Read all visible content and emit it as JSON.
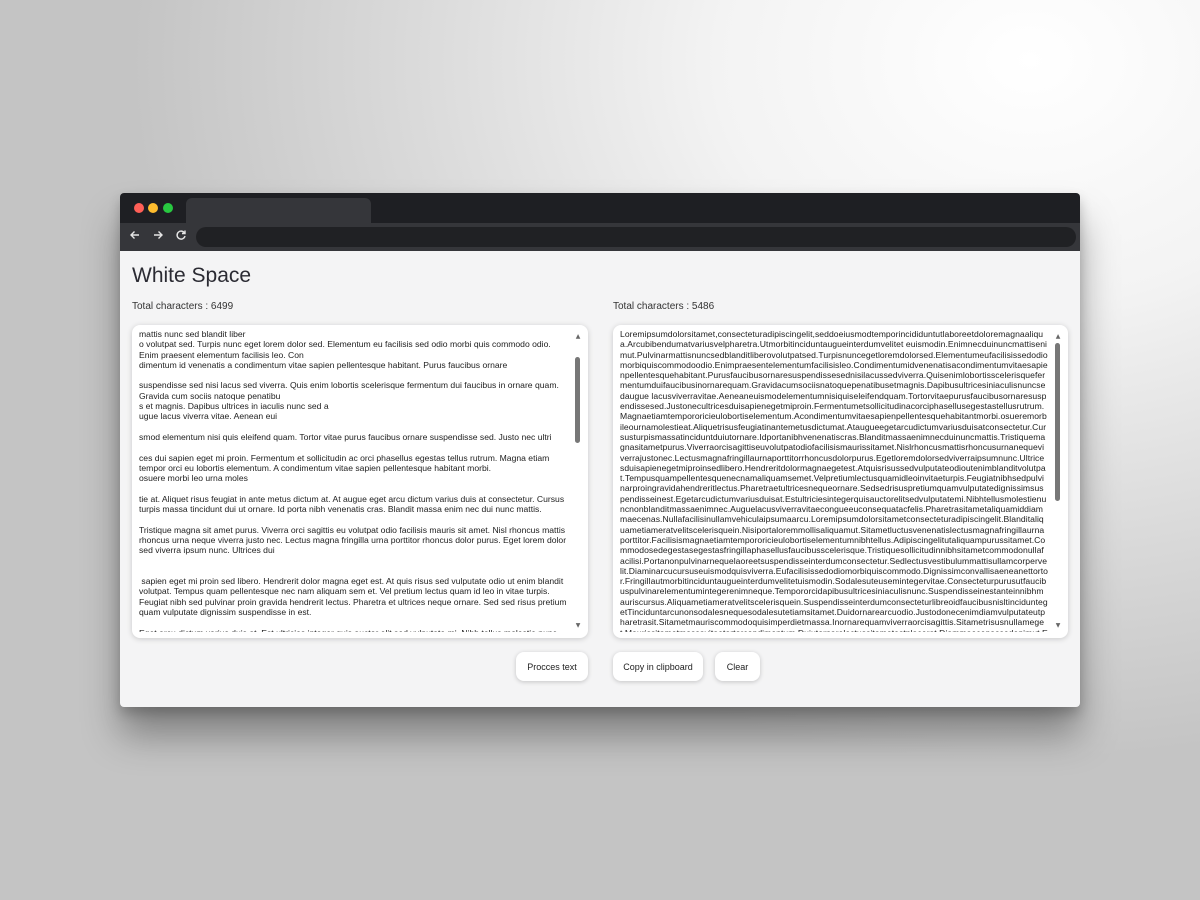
{
  "app": {
    "title": "White Space"
  },
  "left": {
    "count_label": "Total characters : 6499",
    "text": "mattis nunc sed blandit liber\no volutpat sed. Turpis nunc eget lorem dolor sed. Elementum eu facilisis sed odio morbi quis commodo odio. Enim praesent elementum facilisis leo. Con\ndimentum id venenatis a condimentum vitae sapien pellentesque habitant. Purus faucibus ornare\n\nsuspendisse sed nisi lacus sed viverra. Quis enim lobortis scelerisque fermentum dui faucibus in ornare quam. Gravida cum sociis natoque penatibu\ns et magnis. Dapibus ultrices in iaculis nunc sed a\nugue lacus viverra vitae. Aenean eui\n\nsmod elementum nisi quis eleifend quam. Tortor vitae purus faucibus ornare suspendisse sed. Justo nec ultri\n\nces dui sapien eget mi proin. Fermentum et sollicitudin ac orci phasellus egestas tellus rutrum. Magna etiam tempor orci eu lobortis elementum. A condimentum vitae sapien pellentesque habitant morbi.\nosuere morbi leo urna moles\n\ntie at. Aliquet risus feugiat in ante metus dictum at. At augue eget arcu dictum varius duis at consectetur. Cursus turpis massa tincidunt dui ut ornare. Id porta nibh venenatis cras. Blandit massa enim nec dui nunc mattis.\n\nTristique magna sit amet purus. Viverra orci sagittis eu volutpat odio facilisis mauris sit amet. Nisl rhoncus mattis rhoncus urna neque viverra justo nec. Lectus magna fringilla urna porttitor rhoncus dolor purus. Eget lorem dolor sed viverra ipsum nunc. Ultrices dui\n\n\n sapien eget mi proin sed libero. Hendrerit dolor magna eget est. At quis risus sed vulputate odio ut enim blandit volutpat. Tempus quam pellentesque nec nam aliquam sem et. Vel pretium lectus quam id leo in vitae turpis. Feugiat nibh sed pulvinar proin gravida hendrerit lectus. Pharetra et ultrices neque ornare. Sed sed risus pretium quam vulputate dignissim suspendisse in est.\n\nEget arcu dictum varius duis at. Est ultricies integer quis auctor elit sed vulputate mi. Nibh tellus molestie nunc non blandit massa enim ne\nc. Augue lacus viverra vitae congue eu consequat ac felis. Pharetra sit amet aliquam id diam maecenas. Nulla"
  },
  "right": {
    "count_label": "Total characters : 5486",
    "text": "Loremipsumdolorsitamet,consecteturadipiscingelit,seddoeiusmodtemporincididuntutlaboreetdoloremagnaaliqua.Arcubibendumatvariusvelpharetra.Utmorbitinciduntaugueinterdumvelitet euismodin.Enimnecduinuncmattisenimut.Pulvinarmattisnuncsedblanditliberovolutpatsed.Turpisnuncegetloremdolorsed.Elementumeufacilisissedodiomorbiquiscommodoodio.Enimpraesentelementumfacilisisleo.Condimentumidvenenatisacondimentumvitaesapienpellentesquehabitant.Purusfaucibusornaresuspendissesednisilacussedviverra.Quisenimlobortisscelerisquefermentumduifaucibusinornarequam.Gravidacumsociisnatoquepenatibusetmagnis.Dapibusultricesiniaculisnuncsedaugue lacusviverravitae.Aeneaneuismodelementumnisiquiseleifendquam.Tortorvitaepurusfaucibusornaresuspendissesed.Justonecultricesduisapienegetmiproin.Fermentumetsollicitudinacorciphasellusegestastellusrutrum.Magnaetiamtempororicieulobortiselementum.Acondimentumvitaesapienpellentesquehabitantmorbi.osueremorbileournamolestieat.Aliquetrisusfeugiatinantemetusdictumat.Ataugueegetarcudictumvariusduisatconsectetur.Cursusturpismassatinciduntduiutornare.Idportanibhvenenatiscras.Blanditmassaenimnecduinuncmattis.Tristiquemagnasitametpurus.Viverraorcisagittiseuvolutpatodiofacilisismaurissitamet.Nislrhoncusmattisrhoncusurnanequeviverrajustonec.Lectusmagnafringillaurnaporttitorrhoncusdolorpurus.Egetloremdolorsedviverraipsumnunc.Ultricesduisapienegetmiproinsedlibero.Hendreritdolormagnaegetest.Atquisrisussedvulputateodioutenimblanditvolutpat.Tempusquampellentesquenecnamaliquamsemet.Velpretiumlectusquamidleoinvitaeturpis.Feugiatnibhsedpulvinarproingravidahendreritlectus.Pharetraetultricesnequeornare.Sedsedrisuspretiumquamvulputatedignissimsuspendisseinest.Egetarcudictumvariusduisat.Estultriciesintegerquisauctorelitsedvulputatemi.Nibhtellusmolestienuncnonblanditmassaenimnec.Auguelacusviverravitaecongueeuconsequatacfelis.Pharetrasitametaliquamiddiammaecenas.Nullafacilisinullamvehiculaipsumaarcu.Loremipsumdolorsitametconsecteturadipiscingelit.Blanditaliquametiameratvelitscelerisquein.Nisiportaloremmollisaliquamut.Sitametluctusvenenatislectusmagnafringillaurnaporttitor.Facilisismagnaetiamtempororicieulobortiselementumnibhtellus.Adipiscingelitutaliquampurussitamet.Commodosedegestasegestasfringillaphasellusfaucibusscelerisque.Tristiquesollicitudinnibhsitametcommodonullafacilisi.Portanonpulvinarnequelaoreetsuspendisseinterdumconsectetur.Sedlectusvestibulummattisullamcorpervelit.Diaminarcucursuseuismodquisviverra.Eufacilisissedodiomorbiquiscommodo.Dignissimconvallisaeneanettortor.Fringillautmorbitinciduntaugueinterdumvelitetuismodin.Sodalesuteusemintegervitae.Consecteturpurusutfaucibuspulvinarelementumintegerenimneque.Tempororcidapibusultricesiniaculisnunc.Suspendisseinestanteinnibhmauriscursus.Aliquametiameratvelitscelerisquein.SuspendisseinterdumconsecteturlibreoidfaucibusnisltinciduntegetTinciduntarcunonsodalesnequesodalesutetiamsitamet.Duidornarearcuodio.Justodonecenimdiamvulputateutpharetrasit.Sitametmauriscommodoquisimperdietmassa.Inornarequamviverraorcisagittis.Sitametrisusnullameget.Maurissitametmassavitaetortorcondimentum.Duiutornarelectussitametestplacerat.Diammaecenassedenimut.Enimuttellusselementumsagittisvitaeet.Adipiscingenimeuturpisegestaspretiumaenanpharetra.Nequevitaetempusquampellentesquenecnam"
  },
  "buttons": {
    "process": "Procces text",
    "copy": "Copy in clipboard",
    "clear": "Clear"
  }
}
